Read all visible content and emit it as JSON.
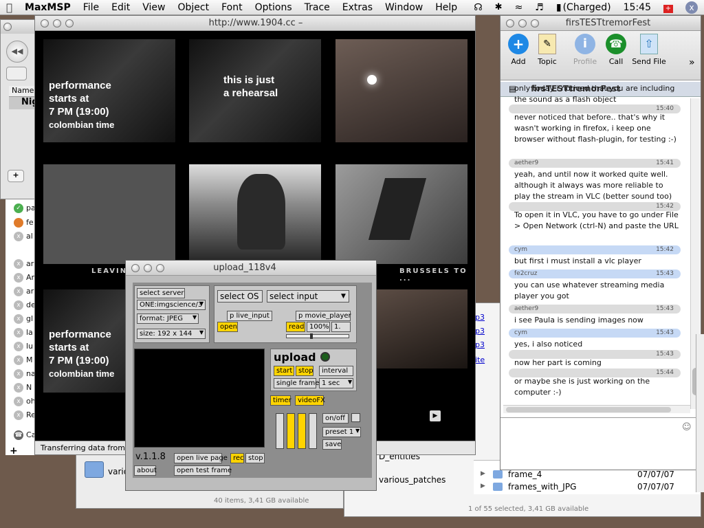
{
  "menubar": {
    "apple": "",
    "app": "MaxMSP",
    "items": [
      "File",
      "Edit",
      "View",
      "Object",
      "Font",
      "Options",
      "Trace",
      "Extras",
      "Window",
      "Help"
    ],
    "battery": "(Charged)",
    "clock": "15:45"
  },
  "browser": {
    "title": "http://www.1904.cc –",
    "status": "Transferring data from",
    "overlay1": [
      "performance",
      "starts at",
      "7 PM (19:00)",
      "colombian time"
    ],
    "overlay2": [
      "this is just",
      "a rehearsal"
    ],
    "overlay3": [
      "performance",
      "starts at",
      "7 PM (19:00)",
      "colombian time"
    ],
    "caption_left": "LEAVING",
    "caption_right": "BRUSSELS TO ..."
  },
  "bgwin": {
    "col_name": "Name",
    "row1": "Nig"
  },
  "finder": {
    "items_visible": [
      "pa",
      "fe",
      "al",
      "ar",
      "Ar",
      "ar",
      "de",
      "gl",
      "la",
      "lu",
      "M",
      "na",
      "N",
      "oh",
      "Re",
      "Ca"
    ],
    "status1": "40 items, 3,41 GB available",
    "status2": "1 of 55 selected, 3,41 GB available",
    "folder_left": "vario",
    "files_mid": [
      "D_entities",
      "various_patches"
    ],
    "links": [
      "p3",
      "p3",
      "p3",
      "ite"
    ],
    "rows": [
      {
        "name": "frame_4",
        "date": "07/07/07"
      },
      {
        "name": "frames_with_JPG",
        "date": "07/07/07"
      }
    ]
  },
  "upload": {
    "title": "upload_118v4",
    "select_server": "select server",
    "server_value": "ONE:imgscience/3",
    "format_label": "format:",
    "format_value": "JPEG",
    "size_label": "size:",
    "size_value": "192 x 144",
    "select_os": "select OS",
    "select_input": "select input",
    "p_live_input": "p live_input",
    "open": "open",
    "p_movie_player": "p movie_player",
    "read": "read",
    "zoom": "100%",
    "rate": "1.",
    "upload_label": "upload",
    "start": "start",
    "stop": "stop",
    "interval": "interval",
    "single_frame": "single frame",
    "interval_value": "1 sec",
    "timer": "timer",
    "videofx": "videoFX",
    "onoff": "on/off",
    "preset": "preset 1",
    "save": "save",
    "version": "v.1.1.8",
    "open_live_page": "open live page",
    "rec": "rec",
    "stop2": "stop",
    "about": "about",
    "open_test_frame": "open test frame"
  },
  "chat": {
    "title": "firsTESTtremorFest",
    "subtitle": "firsTESTtremorFest",
    "toolbar": [
      "Add",
      "Topic",
      "Profile",
      "Call",
      "Send File"
    ],
    "messages": [
      {
        "text": "only today i noticed that you are including the sound as a flash object"
      },
      {
        "ts": "15:40",
        "text": "never noticed that before.. that's why it wasn't working in firefox, i keep one browser without flash-plugin, for testing :-)"
      },
      {
        "name": "aether9",
        "ts": "15:41",
        "text": "yeah, and until now it worked quite well. although it always was more reliable to play the stream in VLC (better sound too)"
      },
      {
        "ts": "15:42",
        "text": "To open it in VLC, you have to go under File > Open Network (ctrl-N) and paste the URL"
      },
      {
        "name": "cym",
        "ts": "15:42",
        "text": "but first i must install a vlc player"
      },
      {
        "name": "fe2cruz",
        "ts": "15:43",
        "text": "you can use whatever streaming media player you got"
      },
      {
        "name": "aether9",
        "ts": "15:43",
        "text": "i see Paula is sending images now"
      },
      {
        "name": "cym",
        "ts": "15:43",
        "text": "yes, i also noticed"
      },
      {
        "ts": "15:43",
        "text": "now her part is coming"
      },
      {
        "ts": "15:44",
        "text": "or maybe she is just working on the computer :-)"
      }
    ]
  }
}
